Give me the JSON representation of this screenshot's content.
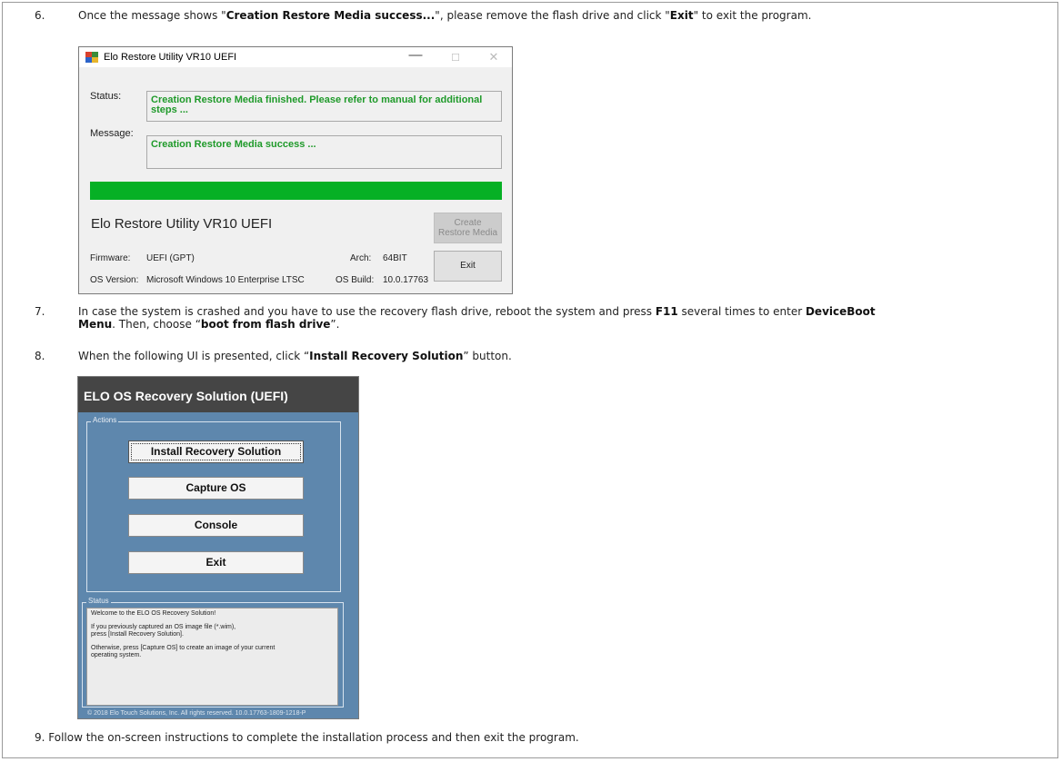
{
  "step6": {
    "num": "6.",
    "pre": "Once the message shows \"",
    "b1": "Creation Restore Media success...",
    "mid": "\", please remove the flash drive and click \"",
    "b2": "Exit",
    "post": "\" to exit the program."
  },
  "restore_window": {
    "title": "Elo Restore Utility VR10 UEFI",
    "minimize": "—",
    "maximize": "☐",
    "close": "✕",
    "status_label": "Status:",
    "status_value": "Creation Restore Media finished.  Please refer to manual for additional steps ...",
    "message_label": "Message:",
    "message_value": "Creation Restore Media success ...",
    "progress_fraction": 1.0,
    "app_title": "Elo Restore Utility VR10 UEFI",
    "create_button_line1": "Create",
    "create_button_line2": "Restore Media",
    "exit_button": "Exit",
    "firmware_label": "Firmware:",
    "firmware_value": "UEFI (GPT)",
    "arch_label": "Arch:",
    "arch_value": "64BIT",
    "os_version_label": "OS Version:",
    "os_version_value": "Microsoft Windows 10 Enterprise LTSC",
    "os_build_label": "OS Build:",
    "os_build_value": "10.0.17763",
    "colors": {
      "progress": "#06b025",
      "status_text": "#1f9a2a"
    }
  },
  "step7": {
    "num": "7.",
    "t1": "In case the system is crashed and you have to use the recovery flash drive, reboot the system and press ",
    "b1": "F11",
    "t2": " several times to enter ",
    "b2": "DeviceBoot",
    "b3": "Menu",
    "t3": ". Then, choose “",
    "b4": "boot from flash drive",
    "t4": "”."
  },
  "step8": {
    "num": "8.",
    "t1": "When the following UI is presented, click “",
    "b1": "Install Recovery Solution",
    "t2": "” button."
  },
  "recovery_window": {
    "header": "ELO OS Recovery Solution (UEFI)",
    "actions_label": "Actions",
    "buttons": [
      "Install Recovery Solution",
      "Capture OS",
      "Console",
      "Exit"
    ],
    "status_label": "Status",
    "status_lines": [
      "Welcome to the ELO OS Recovery Solution!",
      "If you previously captured an OS image file (*.wim),",
      "press [Install Recovery Solution].",
      "Otherwise, press [Capture OS] to create an image of your current",
      "operating system."
    ],
    "footer": "© 2018 Elo Touch Solutions, Inc. All rights reserved. 10.0.17763-1809-1218-P",
    "colors": {
      "background": "#5e87ad",
      "header": "#454545"
    }
  },
  "step9": {
    "text": "9. Follow the on-screen instructions to complete the installation process and then exit the program."
  }
}
